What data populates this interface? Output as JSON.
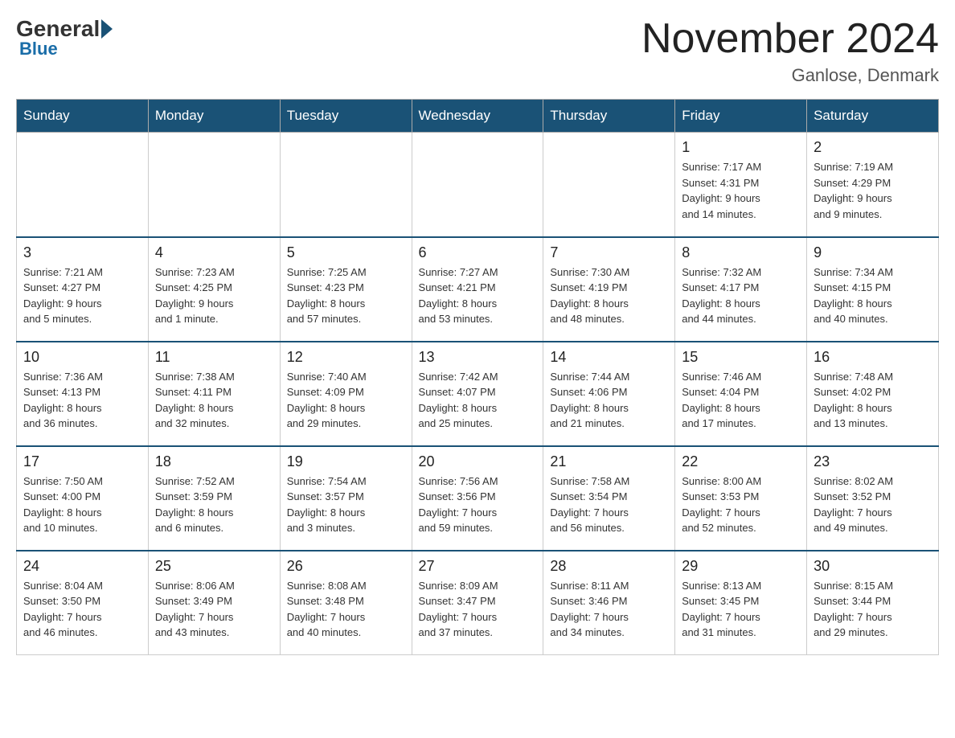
{
  "header": {
    "logo_general": "General",
    "logo_blue": "Blue",
    "month_title": "November 2024",
    "location": "Ganlose, Denmark"
  },
  "days_of_week": [
    "Sunday",
    "Monday",
    "Tuesday",
    "Wednesday",
    "Thursday",
    "Friday",
    "Saturday"
  ],
  "weeks": [
    [
      {
        "day": "",
        "info": ""
      },
      {
        "day": "",
        "info": ""
      },
      {
        "day": "",
        "info": ""
      },
      {
        "day": "",
        "info": ""
      },
      {
        "day": "",
        "info": ""
      },
      {
        "day": "1",
        "info": "Sunrise: 7:17 AM\nSunset: 4:31 PM\nDaylight: 9 hours\nand 14 minutes."
      },
      {
        "day": "2",
        "info": "Sunrise: 7:19 AM\nSunset: 4:29 PM\nDaylight: 9 hours\nand 9 minutes."
      }
    ],
    [
      {
        "day": "3",
        "info": "Sunrise: 7:21 AM\nSunset: 4:27 PM\nDaylight: 9 hours\nand 5 minutes."
      },
      {
        "day": "4",
        "info": "Sunrise: 7:23 AM\nSunset: 4:25 PM\nDaylight: 9 hours\nand 1 minute."
      },
      {
        "day": "5",
        "info": "Sunrise: 7:25 AM\nSunset: 4:23 PM\nDaylight: 8 hours\nand 57 minutes."
      },
      {
        "day": "6",
        "info": "Sunrise: 7:27 AM\nSunset: 4:21 PM\nDaylight: 8 hours\nand 53 minutes."
      },
      {
        "day": "7",
        "info": "Sunrise: 7:30 AM\nSunset: 4:19 PM\nDaylight: 8 hours\nand 48 minutes."
      },
      {
        "day": "8",
        "info": "Sunrise: 7:32 AM\nSunset: 4:17 PM\nDaylight: 8 hours\nand 44 minutes."
      },
      {
        "day": "9",
        "info": "Sunrise: 7:34 AM\nSunset: 4:15 PM\nDaylight: 8 hours\nand 40 minutes."
      }
    ],
    [
      {
        "day": "10",
        "info": "Sunrise: 7:36 AM\nSunset: 4:13 PM\nDaylight: 8 hours\nand 36 minutes."
      },
      {
        "day": "11",
        "info": "Sunrise: 7:38 AM\nSunset: 4:11 PM\nDaylight: 8 hours\nand 32 minutes."
      },
      {
        "day": "12",
        "info": "Sunrise: 7:40 AM\nSunset: 4:09 PM\nDaylight: 8 hours\nand 29 minutes."
      },
      {
        "day": "13",
        "info": "Sunrise: 7:42 AM\nSunset: 4:07 PM\nDaylight: 8 hours\nand 25 minutes."
      },
      {
        "day": "14",
        "info": "Sunrise: 7:44 AM\nSunset: 4:06 PM\nDaylight: 8 hours\nand 21 minutes."
      },
      {
        "day": "15",
        "info": "Sunrise: 7:46 AM\nSunset: 4:04 PM\nDaylight: 8 hours\nand 17 minutes."
      },
      {
        "day": "16",
        "info": "Sunrise: 7:48 AM\nSunset: 4:02 PM\nDaylight: 8 hours\nand 13 minutes."
      }
    ],
    [
      {
        "day": "17",
        "info": "Sunrise: 7:50 AM\nSunset: 4:00 PM\nDaylight: 8 hours\nand 10 minutes."
      },
      {
        "day": "18",
        "info": "Sunrise: 7:52 AM\nSunset: 3:59 PM\nDaylight: 8 hours\nand 6 minutes."
      },
      {
        "day": "19",
        "info": "Sunrise: 7:54 AM\nSunset: 3:57 PM\nDaylight: 8 hours\nand 3 minutes."
      },
      {
        "day": "20",
        "info": "Sunrise: 7:56 AM\nSunset: 3:56 PM\nDaylight: 7 hours\nand 59 minutes."
      },
      {
        "day": "21",
        "info": "Sunrise: 7:58 AM\nSunset: 3:54 PM\nDaylight: 7 hours\nand 56 minutes."
      },
      {
        "day": "22",
        "info": "Sunrise: 8:00 AM\nSunset: 3:53 PM\nDaylight: 7 hours\nand 52 minutes."
      },
      {
        "day": "23",
        "info": "Sunrise: 8:02 AM\nSunset: 3:52 PM\nDaylight: 7 hours\nand 49 minutes."
      }
    ],
    [
      {
        "day": "24",
        "info": "Sunrise: 8:04 AM\nSunset: 3:50 PM\nDaylight: 7 hours\nand 46 minutes."
      },
      {
        "day": "25",
        "info": "Sunrise: 8:06 AM\nSunset: 3:49 PM\nDaylight: 7 hours\nand 43 minutes."
      },
      {
        "day": "26",
        "info": "Sunrise: 8:08 AM\nSunset: 3:48 PM\nDaylight: 7 hours\nand 40 minutes."
      },
      {
        "day": "27",
        "info": "Sunrise: 8:09 AM\nSunset: 3:47 PM\nDaylight: 7 hours\nand 37 minutes."
      },
      {
        "day": "28",
        "info": "Sunrise: 8:11 AM\nSunset: 3:46 PM\nDaylight: 7 hours\nand 34 minutes."
      },
      {
        "day": "29",
        "info": "Sunrise: 8:13 AM\nSunset: 3:45 PM\nDaylight: 7 hours\nand 31 minutes."
      },
      {
        "day": "30",
        "info": "Sunrise: 8:15 AM\nSunset: 3:44 PM\nDaylight: 7 hours\nand 29 minutes."
      }
    ]
  ]
}
